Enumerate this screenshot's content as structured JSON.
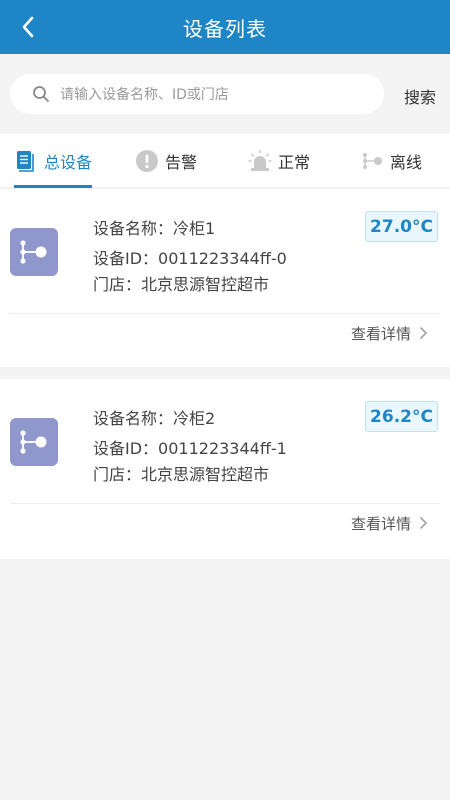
{
  "header": {
    "title": "设备列表",
    "back_icon": "chevron-left-icon"
  },
  "search": {
    "placeholder": "请输入设备名称、ID或门店",
    "button_label": "搜索"
  },
  "tabs": [
    {
      "label": "总设备",
      "icon": "list-icon",
      "active": true
    },
    {
      "label": "告警",
      "icon": "alert-icon",
      "active": false
    },
    {
      "label": "正常",
      "icon": "siren-icon",
      "active": false
    },
    {
      "label": "离线",
      "icon": "offline-icon",
      "active": false
    }
  ],
  "devices": [
    {
      "name_line": "设备名称：冷柜1",
      "id_line": "设备ID：0011223344ff-0",
      "store_line": "门店：北京思源智控超市",
      "temperature": "27.0°C",
      "detail_label": "查看详情"
    },
    {
      "name_line": "设备名称：冷柜2",
      "id_line": "设备ID：0011223344ff-1",
      "store_line": "门店：北京思源智控超市",
      "temperature": "26.2°C",
      "detail_label": "查看详情"
    }
  ],
  "colors": {
    "primary": "#1f86c5",
    "device_icon_bg": "#8f97cd",
    "temp_badge_bg": "#e9f6fc"
  }
}
